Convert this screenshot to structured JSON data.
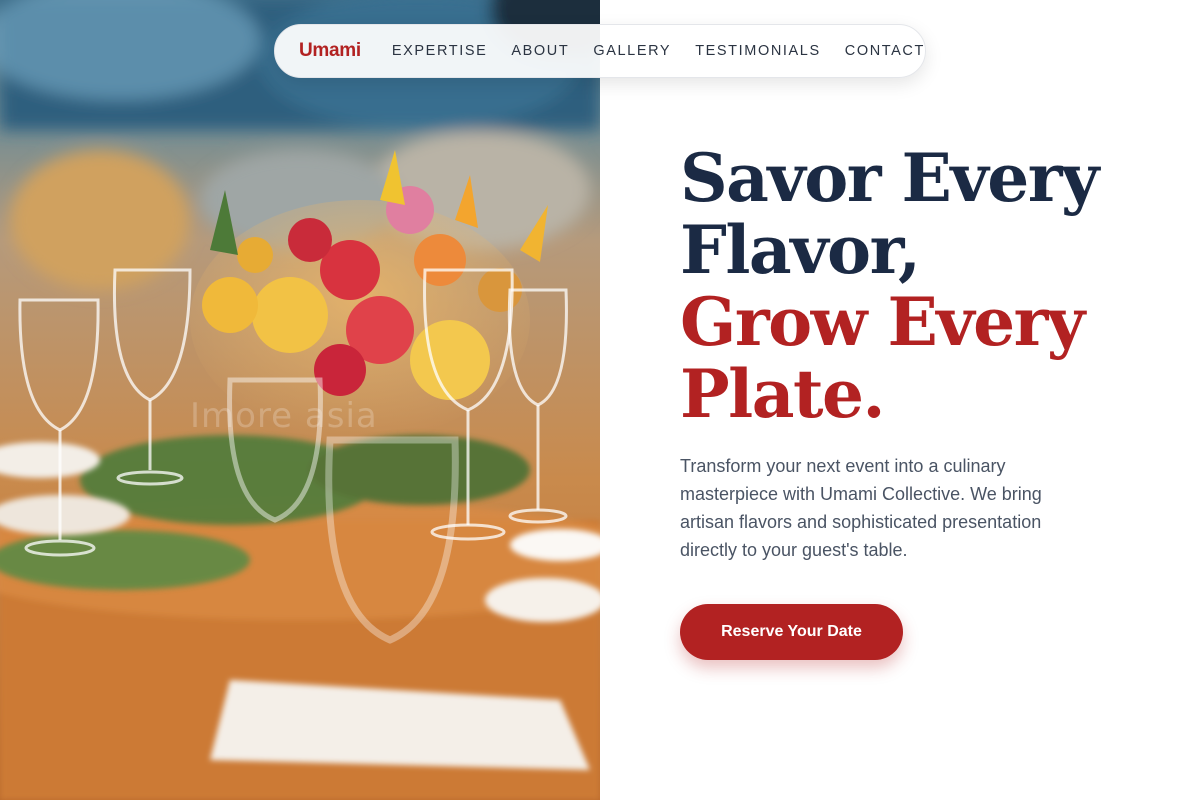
{
  "brand": {
    "name": "Umami"
  },
  "nav": {
    "links": [
      "EXPERTISE",
      "ABOUT",
      "GALLERY",
      "TESTIMONIALS",
      "CONTACT"
    ]
  },
  "hero": {
    "image_watermark": "Imore asia",
    "headline_dark": [
      "Savor Every",
      "Flavor,"
    ],
    "headline_accent": [
      "Grow Every",
      "Plate."
    ],
    "description": "Transform your next event into a culinary masterpiece with Umami Collective. We bring artisan flavors and sophisticated presentation directly to your guest's table.",
    "cta_label": "Reserve Your Date"
  },
  "colors": {
    "accent": "#b22222",
    "heading": "#1b2a44",
    "body_text": "#4a5464"
  },
  "icons": []
}
